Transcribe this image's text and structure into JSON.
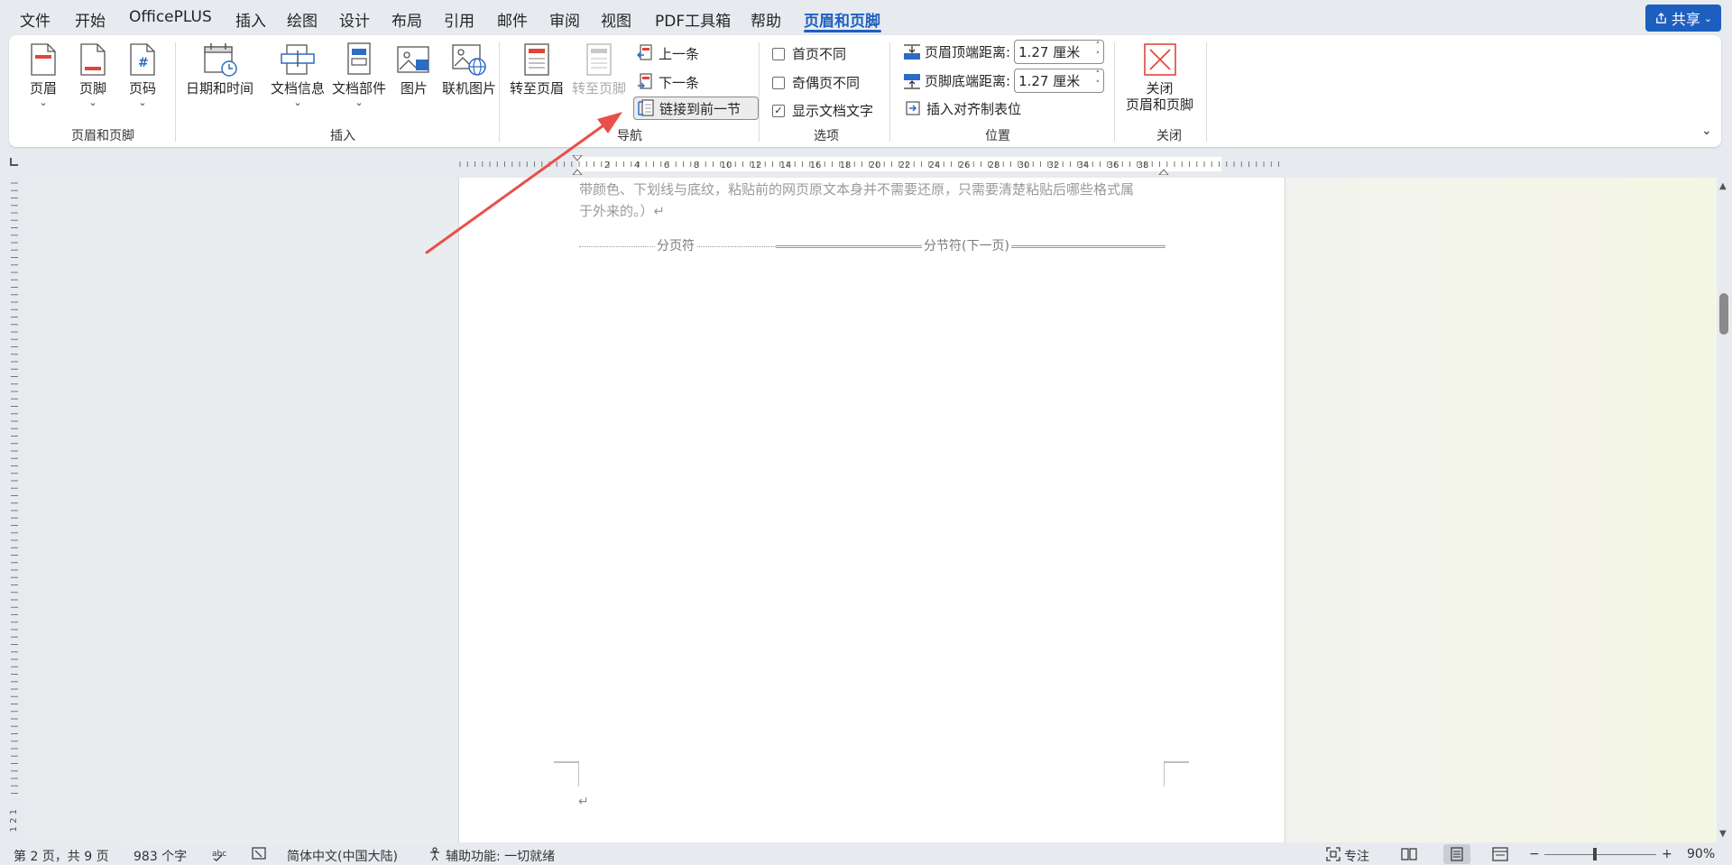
{
  "tabs": [
    "文件",
    "开始",
    "OfficePLUS",
    "插入",
    "绘图",
    "设计",
    "布局",
    "引用",
    "邮件",
    "审阅",
    "视图",
    "PDF工具箱",
    "帮助",
    "页眉和页脚"
  ],
  "active_tab": "页眉和页脚",
  "share_label": "共享",
  "ribbon": {
    "groups": {
      "header_footer": {
        "label": "页眉和页脚",
        "header_label": "页眉",
        "footer_label": "页脚",
        "page_number_label": "页码"
      },
      "insert": {
        "label": "插入",
        "date_time_label": "日期和时间",
        "doc_info_label": "文档信息",
        "quick_parts_label": "文档部件",
        "picture_label": "图片",
        "online_picture_label": "联机图片"
      },
      "navigation": {
        "label": "导航",
        "goto_header_label": "转至页眉",
        "goto_footer_label": "转至页脚",
        "previous_label": "上一条",
        "next_label": "下一条",
        "link_previous_label": "链接到前一节"
      },
      "options": {
        "label": "选项",
        "different_first_page": {
          "label": "首页不同",
          "checked": false
        },
        "different_odd_even": {
          "label": "奇偶页不同",
          "checked": false
        },
        "show_document_text": {
          "label": "显示文档文字",
          "checked": true
        }
      },
      "position": {
        "label": "位置",
        "header_from_top_label": "页眉顶端距离:",
        "header_from_top_value": "1.27 厘米",
        "footer_from_bottom_label": "页脚底端距离:",
        "footer_from_bottom_value": "1.27 厘米",
        "insert_alignment_tab_label": "插入对齐制表位"
      },
      "close": {
        "label": "关闭",
        "close_button_line1": "关闭",
        "close_button_line2": "页眉和页脚"
      }
    }
  },
  "ruler": {
    "numbers": [
      "2",
      "4",
      "6",
      "8",
      "10",
      "12",
      "14",
      "16",
      "18",
      "20",
      "22",
      "24",
      "26",
      "28",
      "30",
      "32",
      "34",
      "36",
      "38"
    ],
    "vertical_label": "1 2 1"
  },
  "document": {
    "text_line1": "带颜色、下划线与底纹，粘贴前的网页原文本身并不需要还原，只需要清楚粘贴后哪些格式属",
    "text_line2": "于外来的。）↵",
    "page_break_label": "分页符",
    "section_break_label": "分节符(下一页)",
    "paragraph_mark": "↵"
  },
  "status_bar": {
    "page_info": "第 2 页，共 9 页",
    "word_count": "983 个字",
    "language": "简体中文(中国大陆)",
    "accessibility": "辅助功能: 一切就绪",
    "focus_label": "专注",
    "zoom_minus": "−",
    "zoom_plus": "+",
    "zoom_level": "90%"
  },
  "colors": {
    "accent": "#1f5fbf",
    "arrow": "#e8504a",
    "header_icon_red": "#e0453a",
    "icon_blue": "#2b6cc4"
  }
}
